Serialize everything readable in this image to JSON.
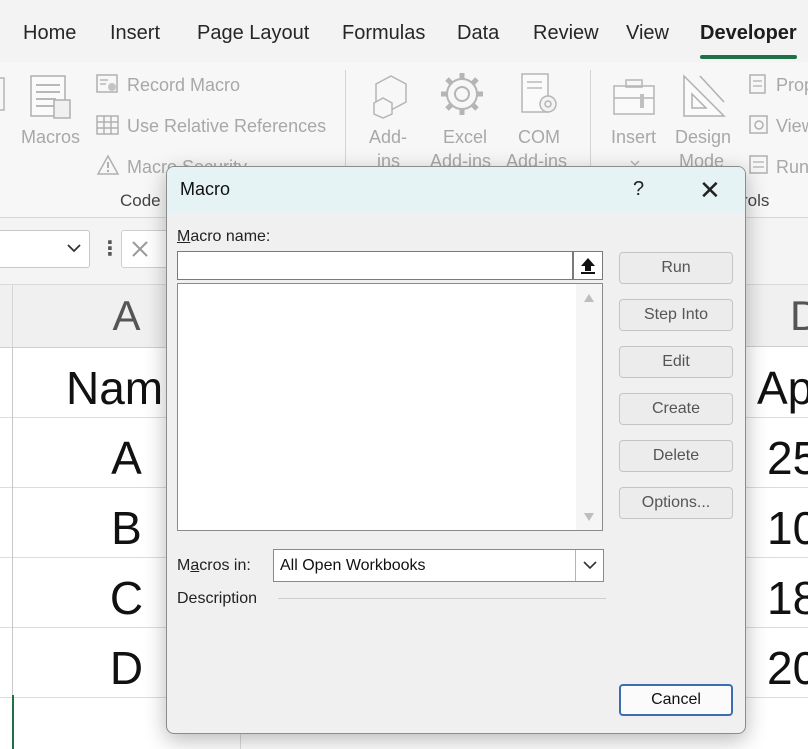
{
  "ribbon_tabs": [
    "Home",
    "Insert",
    "Page Layout",
    "Formulas",
    "Data",
    "Review",
    "View",
    "Developer"
  ],
  "active_tab": "Developer",
  "ribbon": {
    "code_group": {
      "macros_label": "Macros",
      "record_macro": "Record Macro",
      "use_relative": "Use Relative References",
      "macro_security": "Macro Security",
      "group_label": "Code"
    },
    "addins_group": {
      "addins": [
        "Add-",
        "ins"
      ],
      "excel_addins": [
        "Excel",
        "Add-ins"
      ],
      "com_addins": [
        "COM",
        "Add-ins"
      ]
    },
    "controls_group": {
      "insert": "Insert",
      "design_mode": [
        "Design",
        "Mode"
      ],
      "properties": "Prop",
      "view_code": "View",
      "run_dialog": "Run",
      "group_label": "rols"
    }
  },
  "grid": {
    "columns": [
      "A",
      "D"
    ],
    "cells_a": [
      "Nam",
      "A",
      "B",
      "C",
      "D"
    ],
    "cells_d": [
      "Ap",
      "25",
      "10",
      "18",
      "20"
    ]
  },
  "dialog": {
    "title": "Macro",
    "help": "?",
    "close": "✕",
    "macro_name_label_prefix": "M",
    "macro_name_label_rest": "acro name:",
    "macro_name_value": "",
    "buttons": {
      "run": "Run",
      "step_into": "Step Into",
      "edit": "Edit",
      "create": "Create",
      "delete": "Delete",
      "options": "Options...",
      "cancel": "Cancel"
    },
    "macros_in_label_prefix": "M",
    "macros_in_label_u": "a",
    "macros_in_label_rest": "cros in:",
    "macros_in_value": "All Open Workbooks",
    "description_label": "Description"
  },
  "colors": {
    "developer_underline": "#1e7145",
    "dialog_title_bg": "#e6f3f5",
    "cancel_border": "#3c6fb0"
  }
}
